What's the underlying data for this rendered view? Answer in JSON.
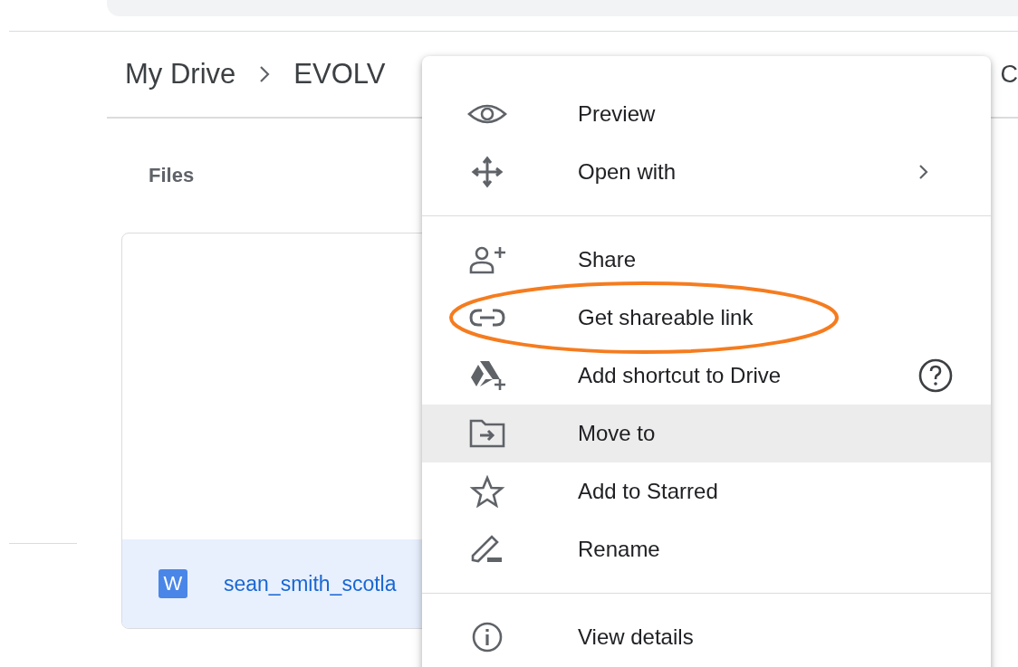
{
  "breadcrumb": {
    "items": [
      "My Drive",
      "EVOLV"
    ],
    "tail": "C"
  },
  "section_title": "Files",
  "file": {
    "badge": "W",
    "name": "sean_smith_scotla",
    "selected": true
  },
  "menu": {
    "groups": [
      [
        {
          "label": "Preview",
          "highlighted": false,
          "submenu": false,
          "help": false,
          "circled": false
        },
        {
          "label": "Open with",
          "highlighted": false,
          "submenu": true,
          "help": false,
          "circled": false
        }
      ],
      [
        {
          "label": "Share",
          "highlighted": false,
          "submenu": false,
          "help": false,
          "circled": false
        },
        {
          "label": "Get shareable link",
          "highlighted": false,
          "submenu": false,
          "help": false,
          "circled": true
        },
        {
          "label": "Add shortcut to Drive",
          "highlighted": false,
          "submenu": false,
          "help": true,
          "circled": false
        },
        {
          "label": "Move to",
          "highlighted": true,
          "submenu": false,
          "help": false,
          "circled": false
        },
        {
          "label": "Add to Starred",
          "highlighted": false,
          "submenu": false,
          "help": false,
          "circled": false
        },
        {
          "label": "Rename",
          "highlighted": false,
          "submenu": false,
          "help": false,
          "circled": false
        }
      ],
      [
        {
          "label": "View details",
          "highlighted": false,
          "submenu": false,
          "help": false,
          "circled": false
        }
      ]
    ]
  }
}
